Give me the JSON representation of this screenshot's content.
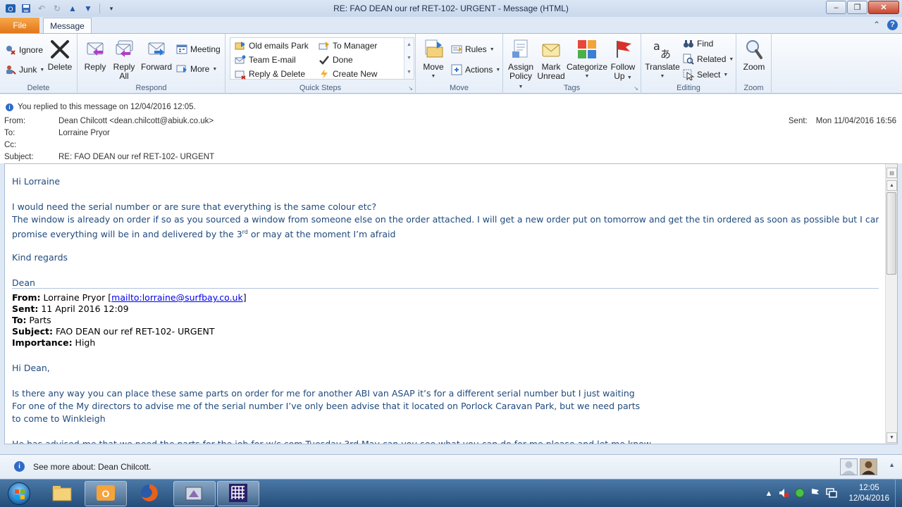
{
  "window": {
    "title": "RE: FAO DEAN our ref RET-102- URGENT  -  Message (HTML)",
    "minimize": "–",
    "maximize": "❐",
    "close": "✕"
  },
  "tabs": {
    "file": "File",
    "message": "Message",
    "collapse": "⌃",
    "help": "?"
  },
  "ribbon": {
    "delete_group": {
      "label": "Delete",
      "ignore": "Ignore",
      "junk": "Junk",
      "delete": "Delete"
    },
    "respond_group": {
      "label": "Respond",
      "reply": "Reply",
      "reply_all_line1": "Reply",
      "reply_all_line2": "All",
      "forward": "Forward",
      "meeting": "Meeting",
      "more": "More"
    },
    "quick_steps_group": {
      "label": "Quick Steps",
      "items": [
        "Old emails Park",
        "To Manager",
        "Team E-mail",
        "Done",
        "Reply & Delete",
        "Create New"
      ]
    },
    "move_group": {
      "label": "Move",
      "move": "Move",
      "rules": "Rules",
      "actions": "Actions"
    },
    "tags_group": {
      "label": "Tags",
      "assign_line1": "Assign",
      "assign_line2": "Policy",
      "mark_line1": "Mark",
      "mark_line2": "Unread",
      "categorize": "Categorize",
      "follow_line1": "Follow",
      "follow_line2": "Up"
    },
    "editing_group": {
      "label": "Editing",
      "translate": "Translate",
      "find": "Find",
      "related": "Related",
      "select": "Select"
    },
    "zoom_group": {
      "label": "Zoom",
      "zoom": "Zoom"
    }
  },
  "header": {
    "info": "You replied to this message on 12/04/2016 12:05.",
    "from_label": "From:",
    "from_value": "Dean Chilcott <dean.chilcott@abiuk.co.uk>",
    "to_label": "To:",
    "to_value": "Lorraine Pryor",
    "cc_label": "Cc:",
    "cc_value": "",
    "subject_label": "Subject:",
    "subject_value": "RE: FAO DEAN our ref RET-102- URGENT",
    "sent_label": "Sent:",
    "sent_value": "Mon 11/04/2016 16:56"
  },
  "body": {
    "greeting": "Hi Lorraine",
    "line1": "I would need the serial number or are sure that everything is the same colour etc?",
    "line2": "The window is already on order if so as you sourced a window from someone else on the order attached. I will get a new order put on tomorrow and get the tin ordered as soon as possible but I can’t",
    "line3_pre": "promise everything will be in and delivered by the 3",
    "line3_sup": "rd",
    "line3_post": " or may at the moment I’m afraid",
    "regards": "Kind regards",
    "signature": "Dean",
    "forwarded": {
      "from_label": "From:",
      "from_name": " Lorraine Pryor [",
      "from_link": "mailto:lorraine@surfbay.co.uk",
      "from_close": "]",
      "sent_label": "Sent:",
      "sent_value": " 11 April 2016 12:09",
      "to_label": "To:",
      "to_value": " Parts",
      "subject_label": "Subject:",
      "subject_value": " FAO DEAN our ref RET-102- URGENT",
      "importance_label": "Importance:",
      "importance_value": " High"
    },
    "orig_greeting": "Hi Dean,",
    "orig_line1": "Is there any way you can place these same parts on order for me for another ABI van ASAP it’s for a different serial number but I just waiting",
    "orig_line2": "For  one of the My directors to advise me of the serial number I’ve only been advise that it located on Porlock Caravan Park, but we need parts",
    "orig_line3": "to come to Winkleigh",
    "orig_line4": "He has advised me that we  need the parts for  the job  for w/c com Tuesday 3rd May can you see what you can do for me please and let me know"
  },
  "people_pane": {
    "text": "See more about: Dean Chilcott."
  },
  "taskbar": {
    "time": "12:05",
    "date": "12/04/2016"
  },
  "colors": {
    "accent_file_tab": "#e2761a",
    "body_text_blue": "#1f497d",
    "info_icon": "#2e6bc7"
  }
}
